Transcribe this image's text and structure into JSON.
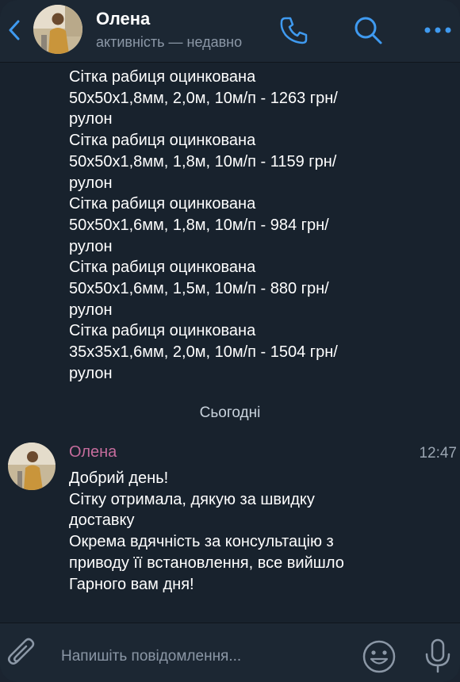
{
  "header": {
    "contact_name": "Олена",
    "status": "активність — недавно"
  },
  "messages": {
    "lines": [
      "Сітка рабиця оцинкована",
      "50х50х1,8мм, 2,0м, 10м/п - 1263 грн/",
      "рулон",
      "Сітка рабиця оцинкована",
      "50х50х1,8мм, 1,8м, 10м/п - 1159 грн/",
      "рулон",
      "Сітка рабиця оцинкована",
      "50х50х1,6мм, 1,8м, 10м/п - 984 грн/",
      "рулон",
      "Сітка рабиця оцинкована",
      "50х50х1,6мм, 1,5м, 10м/п - 880 грн/",
      "рулон",
      "Сітка рабиця оцинкована",
      "35х35х1,6мм, 2,0м, 10м/п - 1504 грн/",
      "рулон"
    ],
    "date_separator": "Сьогодні",
    "incoming": {
      "sender": "Олена",
      "time": "12:47",
      "lines": [
        "Добрий день!",
        "Сітку отримала, дякую за швидку",
        "доставку",
        "Окрема вдячність за консультацію з",
        "приводу її встановлення, все вийшло",
        "Гарного вам дня!"
      ]
    }
  },
  "input": {
    "placeholder": "Напишіть повідомлення..."
  },
  "colors": {
    "background": "#18222d",
    "header": "#1c2733",
    "accent": "#3f9af0",
    "sender_name": "#c56c9c",
    "secondary_text": "#8b97a6"
  },
  "icons": [
    "back-chevron-icon",
    "phone-icon",
    "search-icon",
    "more-icon",
    "paperclip-icon",
    "emoji-icon",
    "microphone-icon"
  ]
}
